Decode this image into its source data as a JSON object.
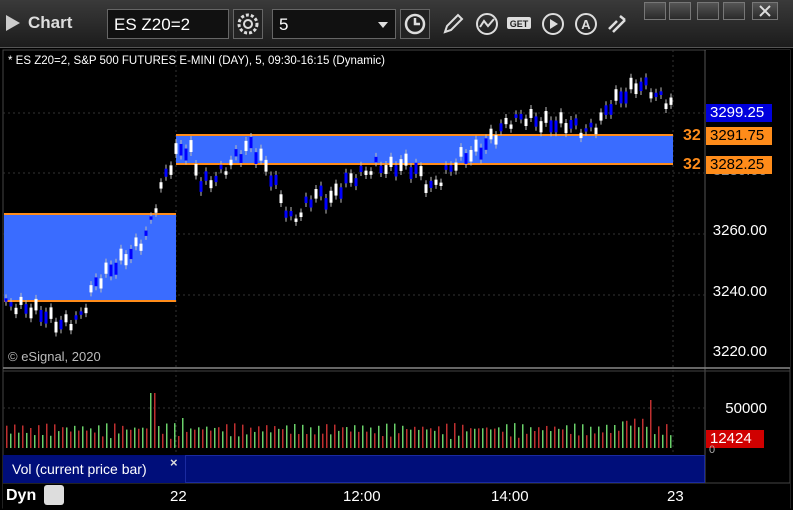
{
  "titlebar": {
    "title": "Chart",
    "symbol": "ES Z20=2",
    "interval": "5"
  },
  "chart": {
    "header": "* ES Z20=2, S&P 500 FUTURES E-MINI (DAY), 5, 09:30-16:15 (Dynamic)",
    "copyright": "© eSignal, 2020",
    "price_axis": [
      "3220.00",
      "3240.00",
      "3260.00",
      "3280.00"
    ],
    "price_tags": {
      "last": "3299.25",
      "upper": "3291.75",
      "lower": "3282.25"
    },
    "side_labels": [
      "32",
      "32"
    ],
    "volume": {
      "label": "Vol (current price bar)",
      "axis": "50000",
      "last": "12424",
      "zero": "0"
    },
    "time_axis": [
      "22",
      "12:00",
      "14:00",
      "23"
    ],
    "footer_label": "Dyn",
    "colors": {
      "background": "#000000",
      "band_fill": "#3a6cff",
      "band_line": "#ff8c1a",
      "up_candle": "#ffffff",
      "down_candle": "#0000ff",
      "last_tag": "#0000dd",
      "orange_tag": "#ff8c1a",
      "vol_tag": "#d00000",
      "vol_up": "#6ad06a",
      "vol_down": "#c03030"
    }
  }
}
